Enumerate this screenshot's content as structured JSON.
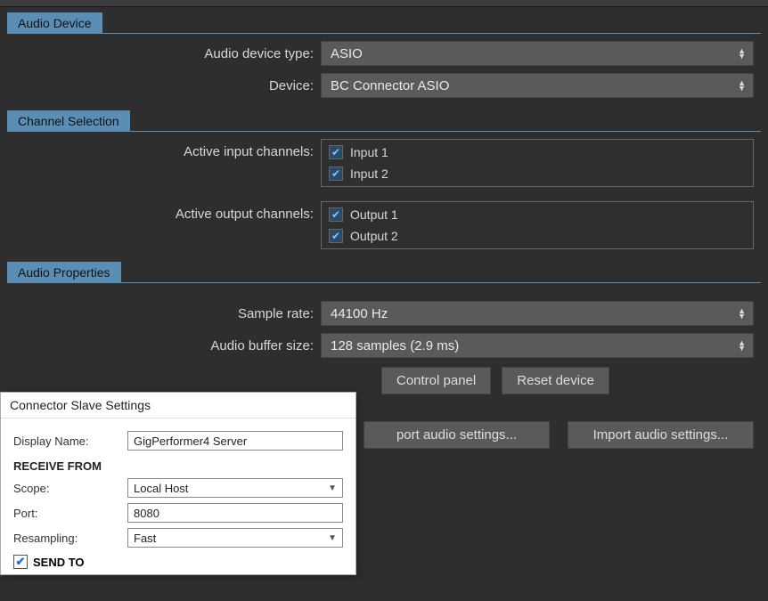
{
  "sections": {
    "audioDevice": {
      "header": "Audio Device",
      "deviceTypeLabel": "Audio device type:",
      "deviceTypeValue": "ASIO",
      "deviceLabel": "Device:",
      "deviceValue": "BC Connector ASIO"
    },
    "channelSelection": {
      "header": "Channel Selection",
      "inputLabel": "Active input channels:",
      "inputs": [
        "Input 1",
        "Input 2"
      ],
      "outputLabel": "Active output channels:",
      "outputs": [
        "Output 1",
        "Output 2"
      ]
    },
    "audioProperties": {
      "header": "Audio Properties",
      "sampleRateLabel": "Sample rate:",
      "sampleRateValue": "44100 Hz",
      "bufferLabel": "Audio buffer size:",
      "bufferValue": "128 samples (2.9 ms)",
      "controlPanel": "Control panel",
      "resetDevice": "Reset device",
      "exportSettings": "port audio settings...",
      "importSettings": "Import audio settings..."
    }
  },
  "popup": {
    "title": "Connector Slave Settings",
    "displayNameLabel": "Display Name:",
    "displayNameValue": "GigPerformer4 Server",
    "receiveFrom": "RECEIVE FROM",
    "scopeLabel": "Scope:",
    "scopeValue": "Local Host",
    "portLabel": "Port:",
    "portValue": "8080",
    "resamplingLabel": "Resampling:",
    "resamplingValue": "Fast",
    "sendTo": "SEND TO"
  }
}
